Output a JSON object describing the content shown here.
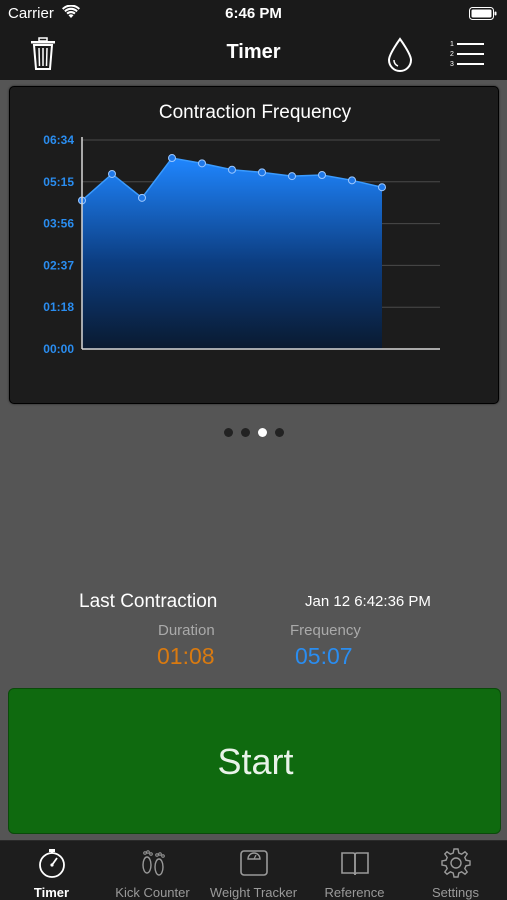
{
  "status_bar": {
    "carrier": "Carrier",
    "time": "6:46 PM"
  },
  "nav": {
    "title": "Timer",
    "icons": [
      "trash-icon",
      "drop-icon",
      "list-icon"
    ]
  },
  "chart": {
    "title": "Contraction Frequency"
  },
  "chart_data": {
    "type": "area",
    "title": "Contraction Frequency",
    "xlabel": "",
    "ylabel": "",
    "y_tick_labels": [
      "00:00",
      "01:18",
      "02:37",
      "03:56",
      "05:15",
      "06:34"
    ],
    "ylim": [
      0,
      394
    ],
    "x": [
      1,
      2,
      3,
      4,
      5,
      6,
      7,
      8,
      9,
      10,
      11
    ],
    "values": [
      280,
      330,
      285,
      360,
      350,
      338,
      333,
      326,
      328,
      318,
      305
    ],
    "color": "#1f78e8",
    "grid": true
  },
  "pager": {
    "count": 4,
    "active": 2
  },
  "last": {
    "label": "Last Contraction",
    "timestamp": "Jan 12 6:42:36 PM",
    "duration_label": "Duration",
    "duration_value": "01:08",
    "frequency_label": "Frequency",
    "frequency_value": "05:07"
  },
  "start": {
    "label": "Start",
    "color": "#0f6a0f"
  },
  "tabs": [
    {
      "label": "Timer",
      "icon": "stopwatch-icon",
      "active": true
    },
    {
      "label": "Kick Counter",
      "icon": "footprints-icon",
      "active": false
    },
    {
      "label": "Weight Tracker",
      "icon": "scale-icon",
      "active": false
    },
    {
      "label": "Reference",
      "icon": "book-icon",
      "active": false
    },
    {
      "label": "Settings",
      "icon": "gear-icon",
      "active": false
    }
  ],
  "colors": {
    "accent_blue": "#2a8df0",
    "accent_orange": "#d97a10",
    "background": "#555555"
  }
}
